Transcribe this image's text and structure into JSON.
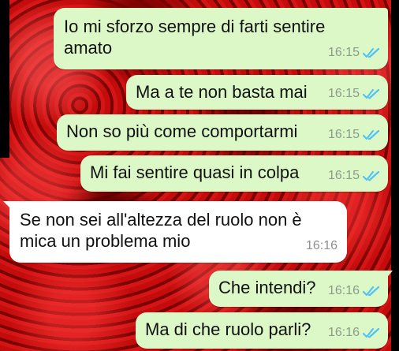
{
  "chat": {
    "messages": [
      {
        "direction": "sent",
        "line1": "Io mi sforzo sempre di farti sentire",
        "line2": "amato",
        "time": "16:15",
        "status": "read"
      },
      {
        "direction": "sent",
        "text": "Ma a te non basta mai",
        "time": "16:15",
        "status": "read"
      },
      {
        "direction": "sent",
        "text": "Non so più come comportarmi",
        "time": "16:15",
        "status": "read"
      },
      {
        "direction": "sent",
        "text": "Mi fai sentire quasi in colpa",
        "time": "16:15",
        "status": "read"
      },
      {
        "direction": "received",
        "line1": "Se non sei all'altezza del ruolo non è",
        "line2": "mica un problema mio",
        "time": "16:16"
      },
      {
        "direction": "sent",
        "text": "Che intendi?",
        "time": "16:16",
        "status": "read"
      },
      {
        "direction": "sent",
        "text": "Ma di che ruolo parli?",
        "time": "16:16",
        "status": "read"
      }
    ]
  },
  "icons": {
    "read_receipt": "double-check-icon"
  },
  "colors": {
    "sent_bubble": "#dcf8c6",
    "received_bubble": "#ffffff",
    "read_tick": "#4fc3f7",
    "wallpaper": "#b00a0a"
  }
}
